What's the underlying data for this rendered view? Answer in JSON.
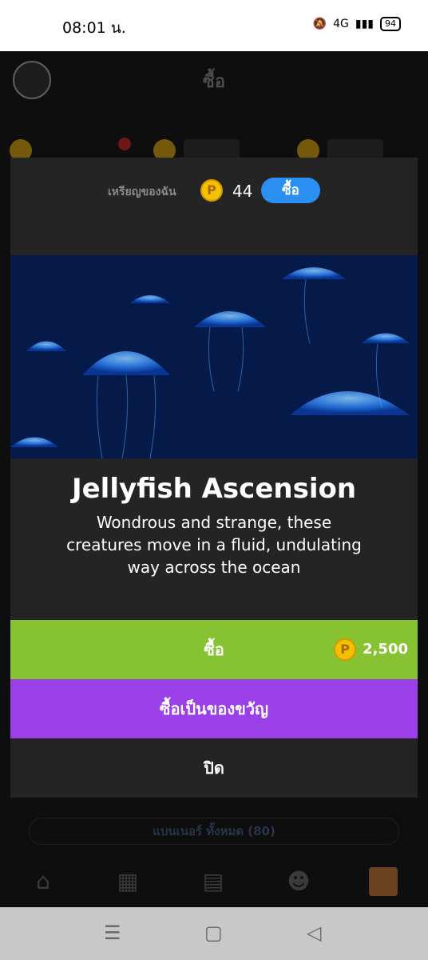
{
  "status": {
    "time": "08:01 น.",
    "network": "4G",
    "battery": "94"
  },
  "header": {
    "title": "ซื้อ"
  },
  "banners_link": "แบนเนอร์ ทั้งหมด (80)",
  "modal": {
    "balance_label": "เหรียญของฉัน",
    "balance_value": "44",
    "buy_coins_label": "ซื้อ",
    "coin_symbol": "P",
    "title": "Jellyfish Ascension",
    "description": "Wondrous and strange, these creatures move in a fluid, undulating way across the ocean",
    "buy_label": "ซื้อ",
    "price": "2,500",
    "gift_label": "ซื้อเป็นของขวัญ",
    "close_label": "ปิด"
  },
  "colors": {
    "buy": "#86c232",
    "gift": "#9b3fe8",
    "accent": "#2a8ff0"
  },
  "icons": [
    "home-icon",
    "cards-icon",
    "chat-icon",
    "friends-icon",
    "chest-icon"
  ]
}
